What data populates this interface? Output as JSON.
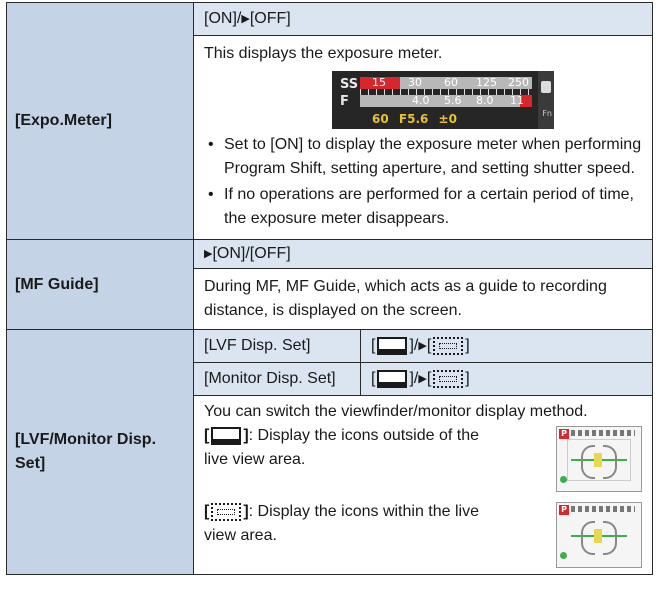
{
  "expo_meter": {
    "label": "[Expo.Meter]",
    "options": "[ON]/",
    "options_default": "[OFF]",
    "description": "This displays the exposure meter.",
    "meter": {
      "ss_label": "SS",
      "f_label": "F",
      "ss_ticks": [
        "15",
        "30",
        "60",
        "125",
        "250"
      ],
      "f_ticks": [
        "4.0",
        "5.6",
        "8.0",
        "11"
      ],
      "bottom_ss": "60",
      "bottom_f": "F5.6",
      "bottom_ev": "±0",
      "side_label": "Fn"
    },
    "bullets": [
      "Set to [ON] to display the exposure meter when performing Program Shift, setting aperture, and setting shutter speed.",
      "If no operations are performed for a certain period of time, the exposure meter disappears."
    ]
  },
  "mf_guide": {
    "label": "[MF Guide]",
    "options_default": "[ON]",
    "options_rest": "/[OFF]",
    "description": "During MF, MF Guide, which acts as a guide to recording distance, is displayed on the screen."
  },
  "lvf": {
    "label": "[LVF/Monitor Disp. Set]",
    "rows": [
      {
        "name": "[LVF Disp. Set]"
      },
      {
        "name": "[Monitor Disp. Set]"
      }
    ],
    "intro": "You can switch the viewfinder/monitor display method.",
    "modes": [
      {
        "text": ": Display the icons outside of the live view area."
      },
      {
        "text": ": Display the icons within the live view area."
      }
    ],
    "thumb_mode": "P"
  }
}
